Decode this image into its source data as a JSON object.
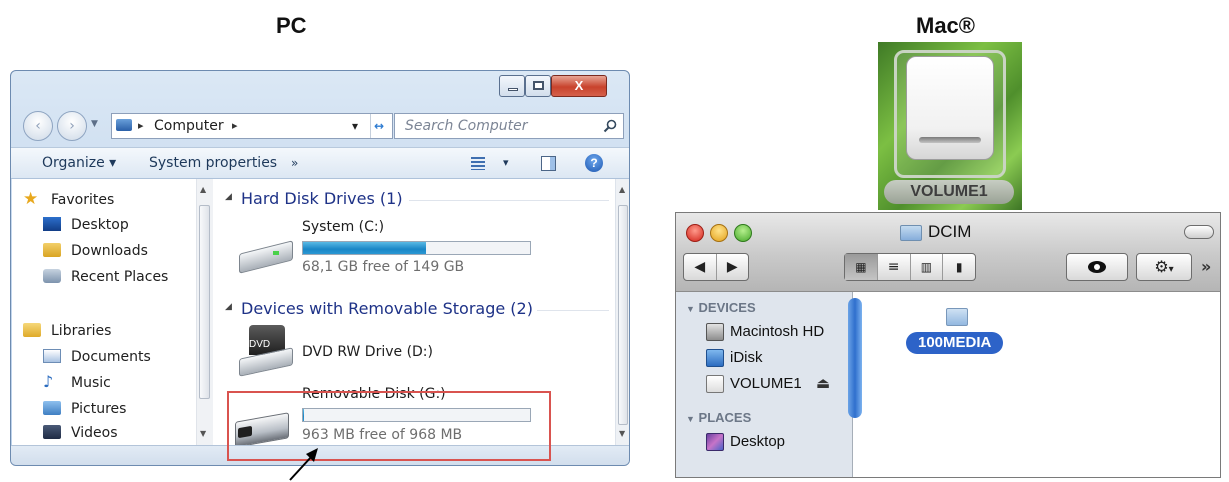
{
  "headings": {
    "pc": "PC",
    "mac": "Mac®"
  },
  "pc": {
    "nav": {
      "back": "‹",
      "forward": "›"
    },
    "address": {
      "separator": "▸",
      "path": "Computer",
      "dropdown": "▾",
      "refresh": "↔"
    },
    "search": {
      "placeholder": "Search Computer",
      "icon": "search-icon"
    },
    "window_controls": {
      "minimize": "–",
      "maximize": "□",
      "close": "X"
    },
    "toolbar": {
      "organize": "Organize ▾",
      "system_properties": "System properties",
      "more": "»",
      "views": "▾",
      "help": "?"
    },
    "nav_pane": {
      "favorites": "Favorites",
      "favorites_items": [
        "Desktop",
        "Downloads",
        "Recent Places"
      ],
      "libraries": "Libraries",
      "libraries_items": [
        "Documents",
        "Music",
        "Pictures",
        "Videos"
      ]
    },
    "content": {
      "hard_disk_group": "Hard Disk Drives (1)",
      "system_drive": {
        "label": "System (C:)",
        "free": "68,1 GB free of 149 GB",
        "used_fraction": 0.54
      },
      "removable_group": "Devices with Removable Storage (2)",
      "dvd_drive": {
        "label": "DVD RW Drive (D:)",
        "badge": "DVD"
      },
      "removable_disk": {
        "label": "Removable Disk (G:)",
        "free": "963 MB free of 968 MB",
        "used_fraction": 0.005
      }
    },
    "colors": {
      "highlight_box": "#d9534f",
      "group_header": "#1e3287"
    }
  },
  "mac": {
    "drive_label": "VOLUME1",
    "window_title": "DCIM",
    "toolbar": {
      "back": "◀",
      "forward": "▶",
      "more": "»",
      "action_caret": "▾"
    },
    "sidebar": {
      "devices": "DEVICES",
      "devices_items": [
        "Macintosh HD",
        "iDisk",
        "VOLUME1"
      ],
      "eject": "⏏",
      "places": "PLACES",
      "places_items": [
        "Desktop"
      ]
    },
    "content": {
      "folder": "100MEDIA"
    }
  }
}
